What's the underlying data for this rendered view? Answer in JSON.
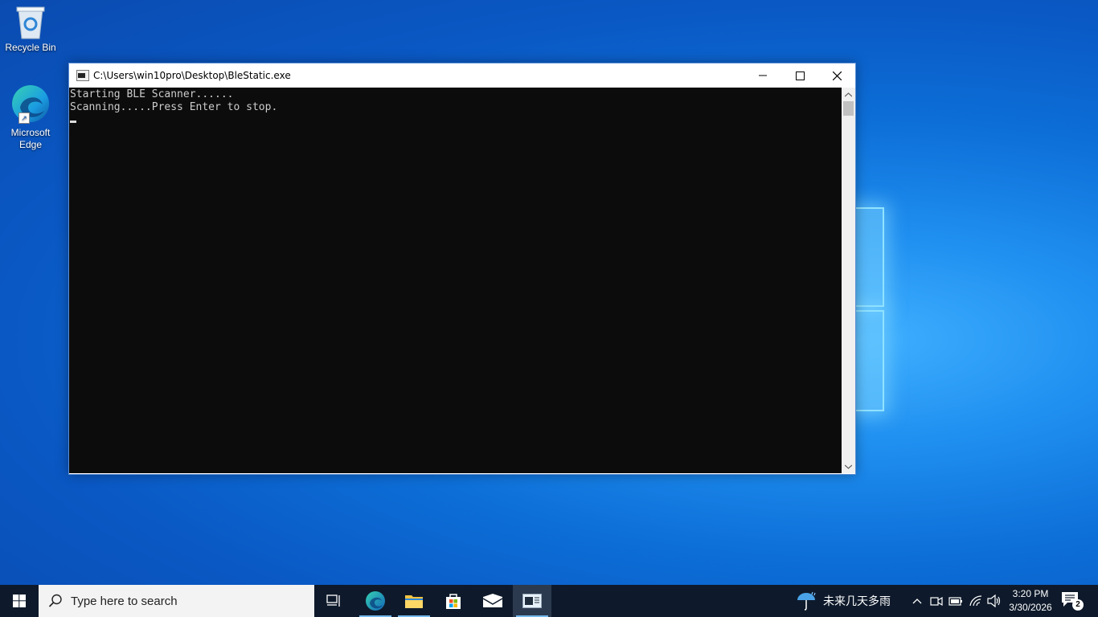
{
  "desktop": {
    "icons": [
      {
        "label": "Recycle Bin",
        "icon": "recycle-bin-icon"
      },
      {
        "label": "Microsoft Edge",
        "icon": "edge-icon"
      }
    ]
  },
  "window": {
    "title": "C:\\Users\\win10pro\\Desktop\\BleStatic.exe",
    "controls": {
      "minimize": "minimize-icon",
      "maximize": "maximize-icon",
      "close": "close-icon"
    },
    "console_lines": [
      "Starting BLE Scanner......",
      "Scanning.....Press Enter to stop."
    ]
  },
  "taskbar": {
    "search_placeholder": "Type here to search",
    "apps": [
      {
        "name": "task-view",
        "icon": "task-view-icon",
        "active": false
      },
      {
        "name": "edge",
        "icon": "edge-icon",
        "active": false
      },
      {
        "name": "file-explorer",
        "icon": "folder-icon",
        "active": false
      },
      {
        "name": "microsoft-store",
        "icon": "store-icon",
        "active": false
      },
      {
        "name": "mail",
        "icon": "mail-icon",
        "active": false
      },
      {
        "name": "blestatic-console",
        "icon": "console-icon",
        "active": true
      }
    ],
    "weather_text": "未来几天多雨",
    "clock_time": "3:20 PM",
    "clock_date": "3/30/2026",
    "notification_count": "2"
  },
  "colors": {
    "console_bg": "#0c0c0c",
    "console_text": "#cccccc",
    "taskbar_bg": "#0e1a2b",
    "accent": "#76b9ed"
  }
}
